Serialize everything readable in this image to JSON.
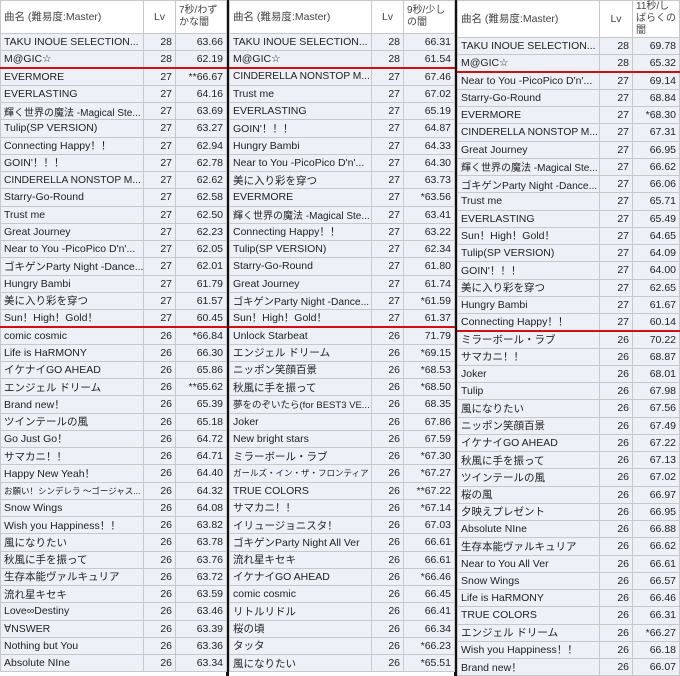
{
  "groups": [
    {
      "headers": {
        "name": "曲名 (難易度:Master)",
        "lv": "Lv",
        "value": "7秒/わずかな闇"
      },
      "rows": [
        [
          "TAKU INOUE SELECTION...",
          "28",
          "63.66"
        ],
        [
          "M@GIC☆",
          "28",
          "62.19"
        ],
        [
          "EVERMORE",
          "27",
          "**66.67"
        ],
        [
          "EVERLASTING",
          "27",
          "64.16"
        ],
        [
          "輝く世界の魔法 -Magical Ste...",
          "27",
          "63.69"
        ],
        [
          "Tulip(SP VERSION)",
          "27",
          "63.27"
        ],
        [
          "Connecting Happy！！",
          "27",
          "62.94"
        ],
        [
          "GOIN'！！！",
          "27",
          "62.78"
        ],
        [
          "CINDERELLA NONSTOP M...",
          "27",
          "62.62"
        ],
        [
          "Starry-Go-Round",
          "27",
          "62.58"
        ],
        [
          "Trust me",
          "27",
          "62.50"
        ],
        [
          "Great Journey",
          "27",
          "62.23"
        ],
        [
          "Near to You -PicoPico D'n'...",
          "27",
          "62.05"
        ],
        [
          "ゴキゲンParty Night -Dance...",
          "27",
          "62.01"
        ],
        [
          "Hungry Bambi",
          "27",
          "61.79"
        ],
        [
          "美に入り彩を穿つ",
          "27",
          "61.57"
        ],
        [
          "Sun！High！Gold！",
          "27",
          "60.45"
        ],
        [
          "comic cosmic",
          "26",
          "*66.84"
        ],
        [
          "Life is HaRMONY",
          "26",
          "66.30"
        ],
        [
          "イケナイGO AHEAD",
          "26",
          "65.86"
        ],
        [
          "エンジェル ドリーム",
          "26",
          "**65.62"
        ],
        [
          "Brand new！",
          "26",
          "65.39"
        ],
        [
          "ツインテールの風",
          "26",
          "65.18"
        ],
        [
          "Go Just Go！",
          "26",
          "64.72"
        ],
        [
          "サマカニ！！",
          "26",
          "64.71"
        ],
        [
          "Happy New Yeah！",
          "26",
          "64.40"
        ],
        [
          "お願い！シンデレラ ～ゴージャス...",
          "26",
          "64.32"
        ],
        [
          "Snow Wings",
          "26",
          "64.08"
        ],
        [
          "Wish you Happiness！！",
          "26",
          "63.82"
        ],
        [
          "風になりたい",
          "26",
          "63.78"
        ],
        [
          "秋風に手を振って",
          "26",
          "63.76"
        ],
        [
          "生存本能ヴァルキュリア",
          "26",
          "63.72"
        ],
        [
          "流れ星キセキ",
          "26",
          "63.59"
        ],
        [
          "Love∞Destiny",
          "26",
          "63.46"
        ],
        [
          "∀NSWER",
          "26",
          "63.39"
        ],
        [
          "Nothing but You",
          "26",
          "63.36"
        ],
        [
          "Absolute NIne",
          "26",
          "63.34"
        ]
      ]
    },
    {
      "headers": {
        "name": "曲名 (難易度:Master)",
        "lv": "Lv",
        "value": "9秒/少しの闇"
      },
      "rows": [
        [
          "TAKU INOUE SELECTION...",
          "28",
          "66.31"
        ],
        [
          "M@GIC☆",
          "28",
          "61.54"
        ],
        [
          "CINDERELLA NONSTOP M...",
          "27",
          "67.46"
        ],
        [
          "Trust me",
          "27",
          "67.02"
        ],
        [
          "EVERLASTING",
          "27",
          "65.19"
        ],
        [
          "GOIN'！！！",
          "27",
          "64.87"
        ],
        [
          "Hungry Bambi",
          "27",
          "64.33"
        ],
        [
          "Near to You -PicoPico D'n'...",
          "27",
          "64.30"
        ],
        [
          "美に入り彩を穿つ",
          "27",
          "63.73"
        ],
        [
          "EVERMORE",
          "27",
          "*63.56"
        ],
        [
          "輝く世界の魔法 -Magical Ste...",
          "27",
          "63.41"
        ],
        [
          "Connecting Happy！！",
          "27",
          "63.22"
        ],
        [
          "Tulip(SP VERSION)",
          "27",
          "62.34"
        ],
        [
          "Starry-Go-Round",
          "27",
          "61.80"
        ],
        [
          "Great Journey",
          "27",
          "61.74"
        ],
        [
          "ゴキゲンParty Night -Dance...",
          "27",
          "*61.59"
        ],
        [
          "Sun！High！Gold！",
          "27",
          "61.37"
        ],
        [
          "Unlock Starbeat",
          "26",
          "71.79"
        ],
        [
          "エンジェル ドリーム",
          "26",
          "*69.15"
        ],
        [
          "ニッポン笑顔百景",
          "26",
          "*68.53"
        ],
        [
          "秋風に手を振って",
          "26",
          "*68.50"
        ],
        [
          "夢をのぞいたら(for BEST3 VE...",
          "26",
          "68.35"
        ],
        [
          "Joker",
          "26",
          "67.86"
        ],
        [
          "New bright stars",
          "26",
          "67.59"
        ],
        [
          "ミラーボール・ラブ",
          "26",
          "*67.30"
        ],
        [
          "ガールズ・イン・ザ・フロンティア",
          "26",
          "*67.27"
        ],
        [
          "TRUE COLORS",
          "26",
          "**67.22"
        ],
        [
          "サマカニ！！",
          "26",
          "*67.14"
        ],
        [
          "イリュージョニスタ！",
          "26",
          "67.03"
        ],
        [
          "ゴキゲンParty Night All Ver",
          "26",
          "66.61"
        ],
        [
          "流れ星キセキ",
          "26",
          "66.61"
        ],
        [
          "イケナイGO AHEAD",
          "26",
          "*66.46"
        ],
        [
          "comic cosmic",
          "26",
          "66.45"
        ],
        [
          "リトルリドル",
          "26",
          "66.41"
        ],
        [
          "桜の頃",
          "26",
          "66.34"
        ],
        [
          "タッタ",
          "26",
          "*66.23"
        ],
        [
          "風になりたい",
          "26",
          "*65.51"
        ]
      ]
    },
    {
      "headers": {
        "name": "曲名 (難易度:Master)",
        "lv": "Lv",
        "value": "11秒/しばらくの闇"
      },
      "rows": [
        [
          "TAKU INOUE SELECTION...",
          "28",
          "69.78"
        ],
        [
          "M@GIC☆",
          "28",
          "65.32"
        ],
        [
          "Near to You -PicoPico D'n'...",
          "27",
          "69.14"
        ],
        [
          "Starry-Go-Round",
          "27",
          "68.84"
        ],
        [
          "EVERMORE",
          "27",
          "*68.30"
        ],
        [
          "CINDERELLA NONSTOP M...",
          "27",
          "67.31"
        ],
        [
          "Great Journey",
          "27",
          "66.95"
        ],
        [
          "輝く世界の魔法 -Magical Ste...",
          "27",
          "66.62"
        ],
        [
          "ゴキゲンParty Night -Dance...",
          "27",
          "66.06"
        ],
        [
          "Trust me",
          "27",
          "65.71"
        ],
        [
          "EVERLASTING",
          "27",
          "65.49"
        ],
        [
          "Sun！High！Gold！",
          "27",
          "64.65"
        ],
        [
          "Tulip(SP VERSION)",
          "27",
          "64.09"
        ],
        [
          "GOIN'！！！",
          "27",
          "64.00"
        ],
        [
          "美に入り彩を穿つ",
          "27",
          "62.65"
        ],
        [
          "Hungry Bambi",
          "27",
          "61.67"
        ],
        [
          "Connecting Happy！！",
          "27",
          "60.14"
        ],
        [
          "ミラーボール・ラブ",
          "26",
          "70.22"
        ],
        [
          "サマカニ！！",
          "26",
          "68.87"
        ],
        [
          "Joker",
          "26",
          "68.01"
        ],
        [
          "Tulip",
          "26",
          "67.98"
        ],
        [
          "風になりたい",
          "26",
          "67.56"
        ],
        [
          "ニッポン笑顔百景",
          "26",
          "67.49"
        ],
        [
          "イケナイGO AHEAD",
          "26",
          "67.22"
        ],
        [
          "秋風に手を振って",
          "26",
          "67.13"
        ],
        [
          "ツインテールの風",
          "26",
          "67.02"
        ],
        [
          "桜の風",
          "26",
          "66.97"
        ],
        [
          "夕映えプレゼント",
          "26",
          "66.95"
        ],
        [
          "Absolute NIne",
          "26",
          "66.88"
        ],
        [
          "生存本能ヴァルキュリア",
          "26",
          "66.62"
        ],
        [
          "Near to You All Ver",
          "26",
          "66.61"
        ],
        [
          "Snow Wings",
          "26",
          "66.57"
        ],
        [
          "Life is HaRMONY",
          "26",
          "66.46"
        ],
        [
          "TRUE COLORS",
          "26",
          "66.31"
        ],
        [
          "エンジェル ドリーム",
          "26",
          "*66.27"
        ],
        [
          "Wish you Happiness！！",
          "26",
          "66.18"
        ],
        [
          "Brand new！",
          "26",
          "66.07"
        ]
      ]
    }
  ]
}
